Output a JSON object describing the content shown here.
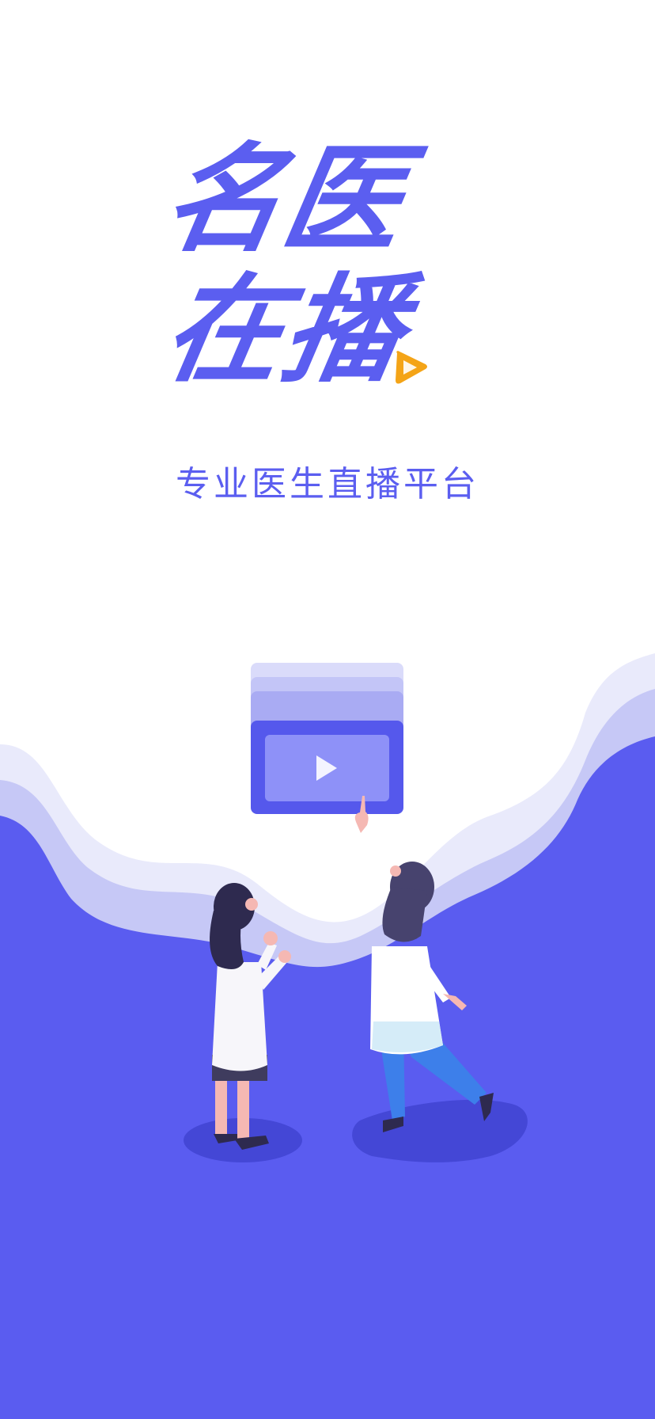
{
  "colors": {
    "brand": "#5b5ef0",
    "accent": "#f4a417",
    "wave_light": "#e9eafb",
    "wave_mid": "#c6c8f6",
    "floor": "#5a5cf0"
  },
  "splash": {
    "logo_line1": "名医",
    "logo_line2": "在播",
    "tagline": "专业医生直播平台"
  },
  "icons": {
    "logo_badge": "play-icon",
    "video_card": "play-icon"
  }
}
